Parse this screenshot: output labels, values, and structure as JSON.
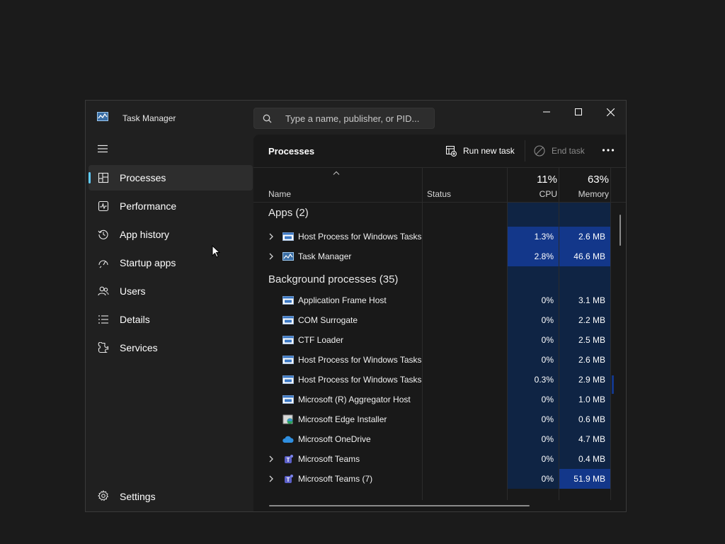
{
  "window": {
    "title": "Task Manager"
  },
  "search": {
    "placeholder": "Type a name, publisher, or PID..."
  },
  "sidebar": {
    "items": [
      {
        "label": "Processes",
        "icon": "processes-icon"
      },
      {
        "label": "Performance",
        "icon": "performance-icon"
      },
      {
        "label": "App history",
        "icon": "app-history-icon"
      },
      {
        "label": "Startup apps",
        "icon": "startup-apps-icon"
      },
      {
        "label": "Users",
        "icon": "users-icon"
      },
      {
        "label": "Details",
        "icon": "details-icon"
      },
      {
        "label": "Services",
        "icon": "services-icon"
      }
    ],
    "settings_label": "Settings"
  },
  "toolbar": {
    "title": "Processes",
    "run_new_task": "Run new task",
    "end_task": "End task"
  },
  "columns": {
    "name": "Name",
    "status": "Status",
    "cpu_percent": "11%",
    "cpu": "CPU",
    "memory_percent": "63%",
    "memory": "Memory"
  },
  "groups": {
    "apps": "Apps (2)",
    "background": "Background processes (35)"
  },
  "apps": [
    {
      "name": "Host Process for Windows Tasks",
      "cpu": "1.3%",
      "memory": "2.6 MB",
      "expandable": true,
      "icon": "window-icon"
    },
    {
      "name": "Task Manager",
      "cpu": "2.8%",
      "memory": "46.6 MB",
      "expandable": true,
      "icon": "task-manager-icon"
    }
  ],
  "background": [
    {
      "name": "Application Frame Host",
      "cpu": "0%",
      "memory": "3.1 MB",
      "expandable": false,
      "icon": "window-icon"
    },
    {
      "name": "COM Surrogate",
      "cpu": "0%",
      "memory": "2.2 MB",
      "expandable": false,
      "icon": "window-icon"
    },
    {
      "name": "CTF Loader",
      "cpu": "0%",
      "memory": "2.5 MB",
      "expandable": false,
      "icon": "window-icon"
    },
    {
      "name": "Host Process for Windows Tasks",
      "cpu": "0%",
      "memory": "2.6 MB",
      "expandable": false,
      "icon": "window-icon"
    },
    {
      "name": "Host Process for Windows Tasks",
      "cpu": "0.3%",
      "memory": "2.9 MB",
      "expandable": false,
      "icon": "window-icon"
    },
    {
      "name": "Microsoft (R) Aggregator Host",
      "cpu": "0%",
      "memory": "1.0 MB",
      "expandable": false,
      "icon": "window-icon"
    },
    {
      "name": "Microsoft Edge Installer",
      "cpu": "0%",
      "memory": "0.6 MB",
      "expandable": false,
      "icon": "edge-installer-icon"
    },
    {
      "name": "Microsoft OneDrive",
      "cpu": "0%",
      "memory": "4.7 MB",
      "expandable": false,
      "icon": "onedrive-icon"
    },
    {
      "name": "Microsoft Teams",
      "cpu": "0%",
      "memory": "0.4 MB",
      "expandable": true,
      "icon": "teams-icon"
    },
    {
      "name": "Microsoft Teams (7)",
      "cpu": "0%",
      "memory": "51.9 MB",
      "expandable": true,
      "icon": "teams-icon"
    }
  ],
  "colors": {
    "accent": "#60cdff",
    "heat_strong": "#13378a",
    "heat_light": "#0f2444"
  }
}
